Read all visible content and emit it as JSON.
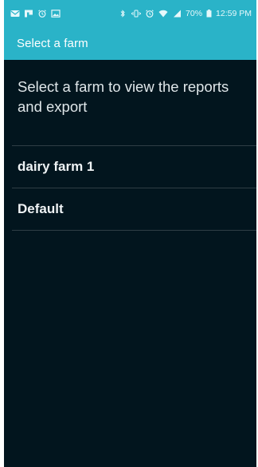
{
  "status_bar": {
    "left_icons": [
      "mail-icon",
      "flipboard-icon",
      "alarm-clock-icon",
      "image-icon"
    ],
    "right_icons": [
      "bluetooth-icon",
      "vibrate-icon",
      "alarm-clock-icon",
      "wifi-icon",
      "signal-icon"
    ],
    "battery": "70%",
    "time": "12:59 PM"
  },
  "header": {
    "title": "Select a farm"
  },
  "main": {
    "instructions": "Select a farm to view the reports and export",
    "farms": [
      {
        "label": "dairy farm 1"
      },
      {
        "label": "Default"
      }
    ]
  },
  "colors": {
    "accent": "#2ab3c8",
    "background": "#02151e",
    "divider": "#2f3e45"
  }
}
